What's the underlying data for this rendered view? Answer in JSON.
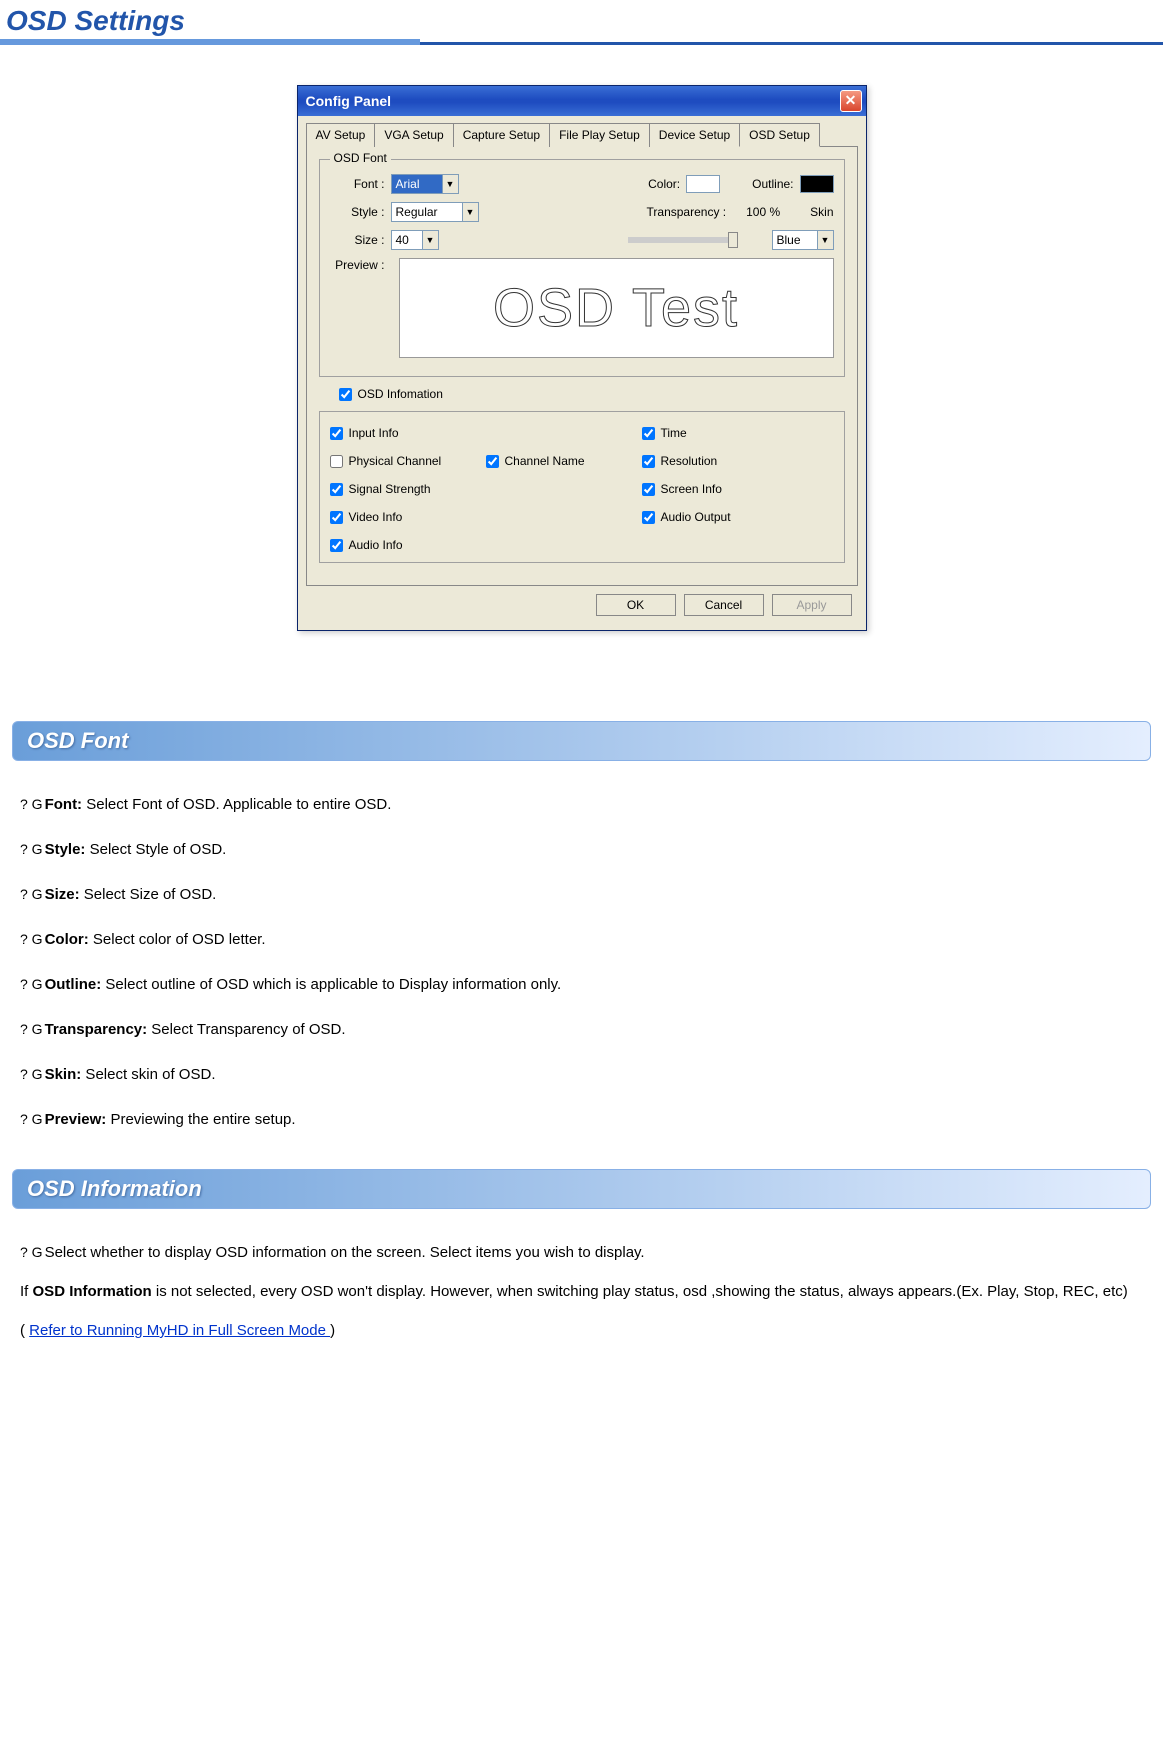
{
  "page_title": "OSD Settings",
  "dialog": {
    "title": "Config Panel",
    "tabs": [
      "AV Setup",
      "VGA Setup",
      "Capture Setup",
      "File Play Setup",
      "Device Setup",
      "OSD Setup"
    ],
    "active_tab": "OSD Setup",
    "group1": {
      "legend": "OSD Font",
      "font_label": "Font :",
      "font_value": "Arial",
      "style_label": "Style :",
      "style_value": "Regular",
      "size_label": "Size :",
      "size_value": "40",
      "color_label": "Color:",
      "outline_label": "Outline:",
      "color_value": "#ffffff",
      "outline_value": "#000000",
      "transparency_label": "Transparency :",
      "transparency_value": "100 %",
      "skin_label": "Skin",
      "skin_value": "Blue",
      "preview_label": "Preview :",
      "preview_text": "OSD Test"
    },
    "osd_info": {
      "main_label": "OSD Infomation",
      "main_checked": true,
      "items": [
        {
          "label": "Input Info",
          "checked": true
        },
        {
          "label": "Time",
          "checked": true
        },
        {
          "label": "Physical Channel",
          "checked": false
        },
        {
          "label": "Channel Name",
          "checked": true
        },
        {
          "label": "Resolution",
          "checked": true
        },
        {
          "label": "Signal Strength",
          "checked": true
        },
        {
          "label": "Screen Info",
          "checked": true
        },
        {
          "label": "Video Info",
          "checked": true
        },
        {
          "label": "Audio Output",
          "checked": true
        },
        {
          "label": "Audio Info",
          "checked": true
        }
      ]
    },
    "buttons": {
      "ok": "OK",
      "cancel": "Cancel",
      "apply": "Apply"
    }
  },
  "section_font": {
    "heading": "OSD Font",
    "bullet": "? G",
    "items": [
      {
        "term": "Font:",
        "desc": " Select Font of OSD. Applicable to entire OSD."
      },
      {
        "term": "Style:",
        "desc": " Select Style of OSD."
      },
      {
        "term": "Size:",
        "desc": " Select Size of OSD."
      },
      {
        "term": "Color:",
        "desc": " Select color of OSD letter."
      },
      {
        "term": "Outline:",
        "desc": " Select outline of OSD which is applicable to Display information only."
      },
      {
        "term": "Transparency:",
        "desc": " Select Transparency of OSD."
      },
      {
        "term": "Skin:",
        "desc": " Select skin of OSD."
      },
      {
        "term": "Preview:",
        "desc": "   Previewing the entire setup."
      }
    ]
  },
  "section_info": {
    "heading": "OSD Information",
    "intro_bullet": "? G",
    "intro": "Select whether to display OSD information on the screen. Select items you wish to display.",
    "body_prefix": "  If ",
    "body_bold": "OSD Information",
    "body_rest": " is not selected, every OSD won't display. However, when switching play status, osd ,showing the status, always appears.(Ex. Play, Stop, REC, etc)",
    "link_prefix": "( ",
    "link_text": "Refer to Running MyHD in Full Screen Mode ",
    "link_suffix": ")"
  }
}
